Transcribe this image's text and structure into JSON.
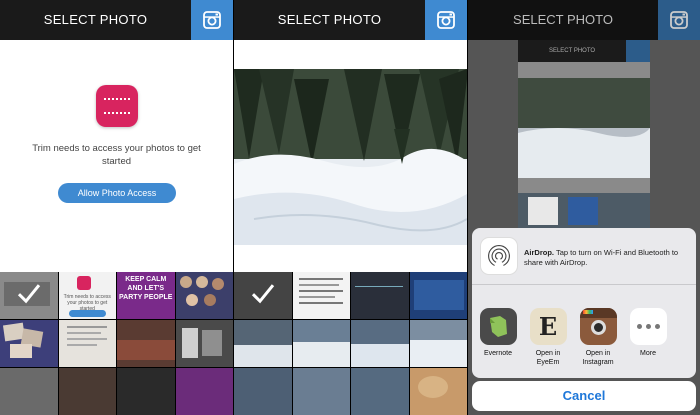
{
  "panels": {
    "left": {
      "title": "SELECT PHOTO",
      "access_message": "Trim needs to access your photos to get started",
      "allow_button": "Allow Photo Access",
      "thumbs": [
        {
          "text": ""
        },
        {
          "text": "Trim needs to access your photos to get started"
        },
        {
          "text": "KEEP CALM AND LET'S PARTY PEOPLE"
        },
        {
          "text": ""
        }
      ]
    },
    "middle": {
      "title": "SELECT PHOTO"
    },
    "right": {
      "title": "SELECT PHOTO",
      "mini_title": "SELECT PHOTO",
      "airdrop_title": "AirDrop.",
      "airdrop_text": "Tap to turn on Wi-Fi and Bluetooth to share with AirDrop.",
      "share_apps": [
        {
          "label": "Evernote",
          "icon": "evernote-icon"
        },
        {
          "label": "Open in EyeEm",
          "icon": "eyeem-icon"
        },
        {
          "label": "Open in Instagram",
          "icon": "instagram-icon"
        },
        {
          "label": "More",
          "icon": "more-icon"
        }
      ],
      "cancel": "Cancel"
    }
  },
  "colors": {
    "topbar": "#1a1a1a",
    "accent": "#3f8ad1",
    "trim_brand": "#d8245f",
    "cancel_text": "#1e77d9"
  }
}
